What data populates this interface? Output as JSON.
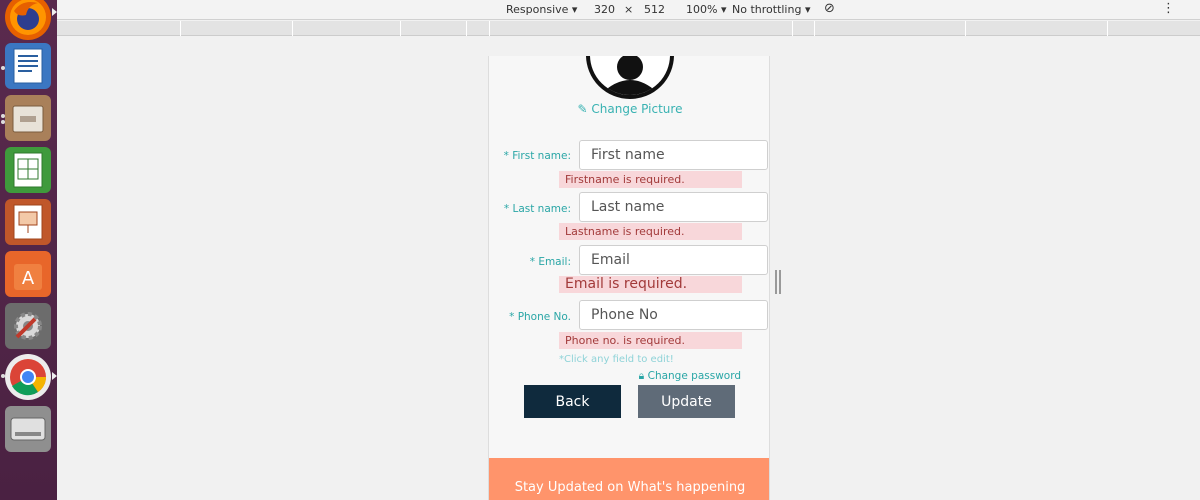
{
  "devtools": {
    "device": "Responsive",
    "width": "320",
    "times": "×",
    "height": "512",
    "zoom": "100%",
    "throttling": "No throttling"
  },
  "profile": {
    "change_picture": "Change Picture",
    "fields": [
      {
        "label": "* First name:",
        "placeholder": "First name",
        "error": "Firstname is required."
      },
      {
        "label": "* Last name:",
        "placeholder": "Last name",
        "error": "Lastname is required."
      },
      {
        "label": "* Email:",
        "placeholder": "Email",
        "error": "Email is required."
      },
      {
        "label": "* Phone No.",
        "placeholder": "Phone No",
        "error": "Phone no. is required."
      }
    ],
    "hint": "*Click any field to edit!",
    "change_password": "Change password",
    "back_label": "Back",
    "update_label": "Update",
    "footer_text": "Stay Updated on What's happening"
  },
  "colors": {
    "accent": "#2aa6a6",
    "back_button": "#0f2a3d",
    "update_button": "#5f6b78",
    "error_bg": "#f8d7da",
    "footer_bg": "#ff946b"
  }
}
